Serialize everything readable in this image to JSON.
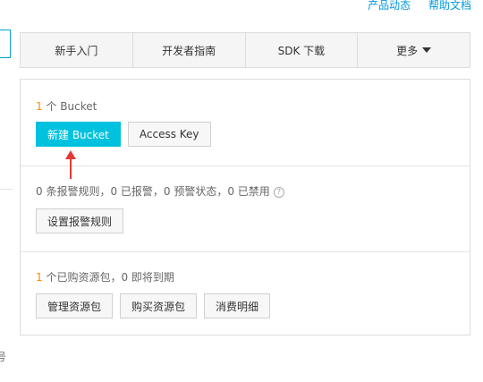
{
  "top_links": [
    "产品动态",
    "帮助文档"
  ],
  "left_edge_char": "号",
  "tabs": [
    {
      "label": "新手入门"
    },
    {
      "label": "开发者指南"
    },
    {
      "label": "SDK 下载"
    },
    {
      "label": "更多"
    }
  ],
  "bucket": {
    "count": "1",
    "count_suffix": "个 Bucket",
    "new_button": "新建 Bucket",
    "access_key_button": "Access Key"
  },
  "alarm": {
    "status_text": "0 条报警规则，0 已报警，0 预警状态，0 已禁用",
    "help_symbol": "?",
    "set_rules_button": "设置报警规则"
  },
  "resource": {
    "count": "1",
    "status_text": "个已购资源包，0 即将到期",
    "buttons": [
      "管理资源包",
      "购买资源包",
      "消费明细"
    ]
  },
  "colors": {
    "accent": "#00c1de",
    "link": "#0099dd",
    "highlight_number": "#ff8a00",
    "annotation_arrow": "#e53935"
  },
  "icons": {
    "tab_more": "caret-down-icon",
    "alarm_help": "question-circle-icon",
    "annotation": "red-arrow-up-icon"
  }
}
